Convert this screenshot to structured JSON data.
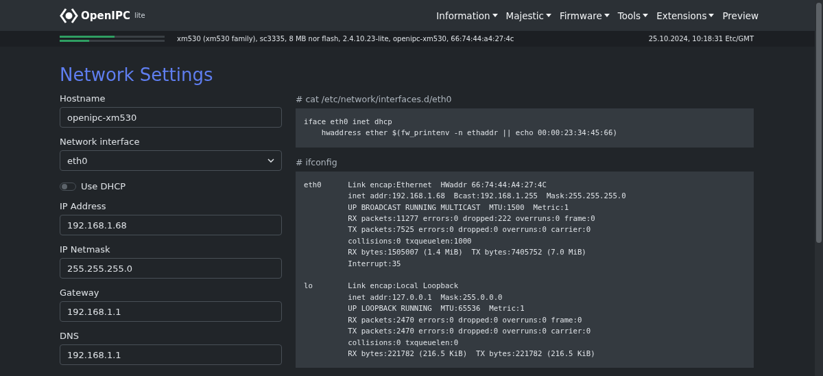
{
  "navbar": {
    "brand": "OpenIPC",
    "brand_suffix": "lite",
    "items": [
      {
        "label": "Information",
        "dropdown": true
      },
      {
        "label": "Majestic",
        "dropdown": true
      },
      {
        "label": "Firmware",
        "dropdown": true
      },
      {
        "label": "Tools",
        "dropdown": true
      },
      {
        "label": "Extensions",
        "dropdown": true
      },
      {
        "label": "Preview",
        "dropdown": false
      }
    ]
  },
  "info_bar": {
    "meters": [
      {
        "level": 0.52
      },
      {
        "level": 0.28
      }
    ],
    "device": "xm530 (xm530 family), sc3335, 8 MB nor flash, 2.4.10.23-lite, openipc-xm530, 66:74:44:a4:27:4c",
    "datetime": "25.10.2024, 10:18:31 Etc/GMT"
  },
  "title": "Network Settings",
  "form": [
    {
      "kind": "input",
      "label": "Hostname",
      "value": "openipc-xm530"
    },
    {
      "kind": "select",
      "label": "Network interface",
      "value": "eth0"
    },
    {
      "kind": "switch",
      "label": "Use DHCP",
      "checked": false
    },
    {
      "kind": "input",
      "label": "IP Address",
      "value": "192.168.1.68"
    },
    {
      "kind": "input",
      "label": "IP Netmask",
      "value": "255.255.255.0"
    },
    {
      "kind": "input",
      "label": "Gateway",
      "value": "192.168.1.1"
    },
    {
      "kind": "input",
      "label": "DNS",
      "value": "192.168.1.1"
    }
  ],
  "outputs": [
    {
      "command": "# cat /etc/network/interfaces.d/eth0",
      "output": "iface eth0 inet dhcp\n    hwaddress ether $(fw_printenv -n ethaddr || echo 00:00:23:34:45:66)"
    },
    {
      "command": "# ifconfig",
      "output": "eth0      Link encap:Ethernet  HWaddr 66:74:44:A4:27:4C\n          inet addr:192.168.1.68  Bcast:192.168.1.255  Mask:255.255.255.0\n          UP BROADCAST RUNNING MULTICAST  MTU:1500  Metric:1\n          RX packets:11277 errors:0 dropped:222 overruns:0 frame:0\n          TX packets:7525 errors:0 dropped:0 overruns:0 carrier:0\n          collisions:0 txqueuelen:1000\n          RX bytes:1505007 (1.4 MiB)  TX bytes:7405752 (7.0 MiB)\n          Interrupt:35\n\nlo        Link encap:Local Loopback\n          inet addr:127.0.0.1  Mask:255.0.0.0\n          UP LOOPBACK RUNNING  MTU:65536  Metric:1\n          RX packets:2470 errors:0 dropped:0 overruns:0 frame:0\n          TX packets:2470 errors:0 dropped:0 overruns:0 carrier:0\n          collisions:0 txqueuelen:0\n          RX bytes:221782 (216.5 KiB)  TX bytes:221782 (216.5 KiB)"
    }
  ]
}
